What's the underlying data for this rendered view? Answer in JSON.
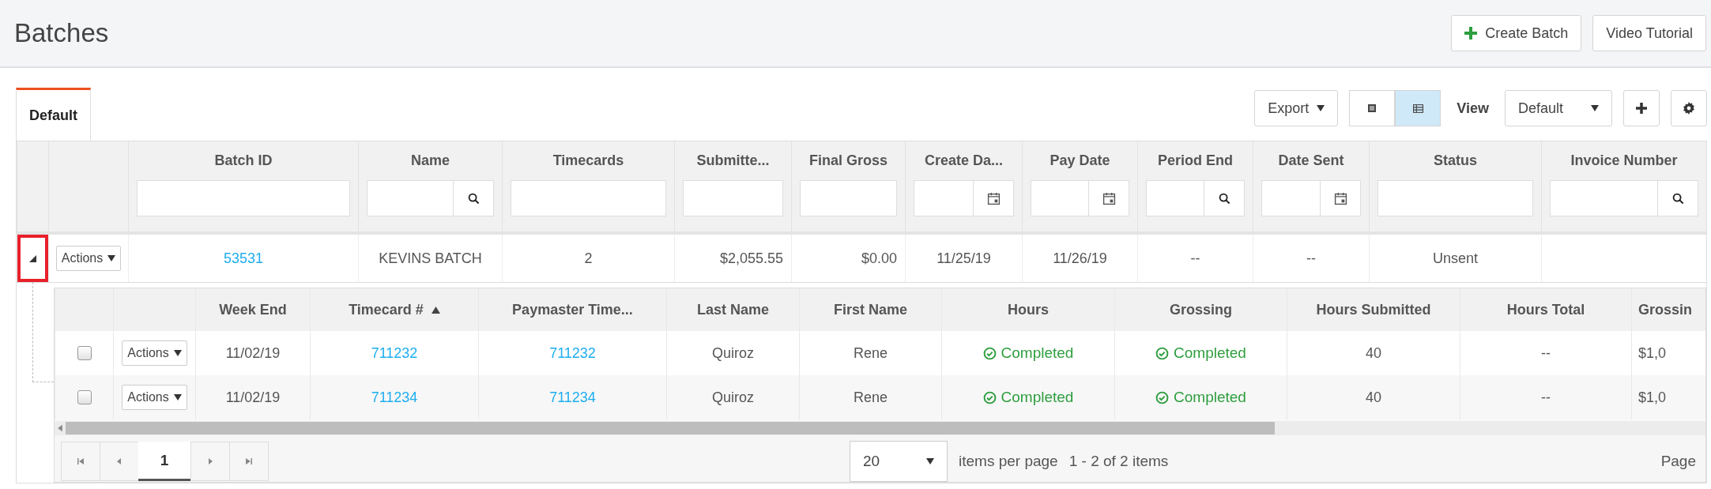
{
  "page": {
    "title": "Batches",
    "buttons": [
      {
        "label": "Create Batch",
        "kind": "create"
      },
      {
        "label": "Video Tutorial",
        "kind": "plain"
      }
    ]
  },
  "tabs": [
    {
      "label": "Default",
      "selected": true
    }
  ],
  "toolbar": {
    "export": "Export",
    "view_modes": [
      {
        "kind": "list",
        "selected": false
      },
      {
        "kind": "table",
        "selected": true
      }
    ],
    "view_label": "View",
    "view_value": "Default"
  },
  "batches": {
    "columns": [
      {
        "label": "Batch ID",
        "kind": "text"
      },
      {
        "label": "Name",
        "kind": "search"
      },
      {
        "label": "Timecards",
        "kind": "text"
      },
      {
        "label": "Submitte...",
        "kind": "text"
      },
      {
        "label": "Final Gross",
        "kind": "text"
      },
      {
        "label": "Create Da...",
        "kind": "date"
      },
      {
        "label": "Pay Date",
        "kind": "date"
      },
      {
        "label": "Period End",
        "kind": "search"
      },
      {
        "label": "Date Sent",
        "kind": "date"
      },
      {
        "label": "Status",
        "kind": "text"
      },
      {
        "label": "Invoice Number",
        "kind": "search"
      }
    ],
    "rows": [
      {
        "expanded": true,
        "highlighted": true,
        "actions": "Actions",
        "cells": [
          {
            "text": "53531",
            "kind": "link"
          },
          {
            "text": "KEVINS BATCH",
            "kind": "text"
          },
          {
            "text": "2",
            "kind": "text"
          },
          {
            "text": "$2,055.55",
            "kind": "text"
          },
          {
            "text": "$0.00",
            "kind": "text"
          },
          {
            "text": "11/25/19",
            "kind": "text"
          },
          {
            "text": "11/26/19",
            "kind": "text"
          },
          {
            "text": "--",
            "kind": "text"
          },
          {
            "text": "--",
            "kind": "text"
          },
          {
            "text": "Unsent",
            "kind": "text"
          }
        ]
      }
    ]
  },
  "timecards": {
    "columns": [
      {
        "label": "Week End"
      },
      {
        "label": "Timecard #",
        "sorted": true
      },
      {
        "label": "Paymaster Time..."
      },
      {
        "label": "Last Name"
      },
      {
        "label": "First Name"
      },
      {
        "label": "Hours"
      },
      {
        "label": "Grossing"
      },
      {
        "label": "Hours Submitted"
      },
      {
        "label": "Hours Total"
      },
      {
        "label": "Grossin"
      }
    ],
    "rows": [
      {
        "checked": false,
        "actions": "Actions",
        "cells": [
          {
            "text": "11/02/19",
            "kind": "text"
          },
          {
            "text": "711232",
            "kind": "link"
          },
          {
            "text": "711232",
            "kind": "link"
          },
          {
            "text": "Quiroz",
            "kind": "text"
          },
          {
            "text": "Rene",
            "kind": "text"
          },
          {
            "text": "Completed",
            "kind": "status"
          },
          {
            "text": "Completed",
            "kind": "status"
          },
          {
            "text": "40",
            "kind": "text"
          },
          {
            "text": "--",
            "kind": "text"
          },
          {
            "text": "$1,0",
            "kind": "text"
          }
        ]
      },
      {
        "checked": false,
        "actions": "Actions",
        "cells": [
          {
            "text": "11/02/19",
            "kind": "text"
          },
          {
            "text": "711234",
            "kind": "link"
          },
          {
            "text": "711234",
            "kind": "link"
          },
          {
            "text": "Quiroz",
            "kind": "text"
          },
          {
            "text": "Rene",
            "kind": "text"
          },
          {
            "text": "Completed",
            "kind": "status"
          },
          {
            "text": "Completed",
            "kind": "status"
          },
          {
            "text": "40",
            "kind": "text"
          },
          {
            "text": "--",
            "kind": "text"
          },
          {
            "text": "$1,0",
            "kind": "text"
          }
        ]
      }
    ],
    "pager": {
      "pages": [
        {
          "label": "1",
          "selected": true
        }
      ],
      "page_size": "20",
      "page_size_label": "items per page",
      "summary": "1 - 2 of 2 items",
      "page_label": "Page"
    }
  }
}
